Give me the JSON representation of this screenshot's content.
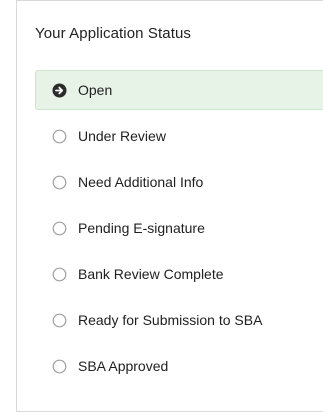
{
  "panel": {
    "title": "Your Application Status"
  },
  "steps": [
    {
      "label": "Open",
      "state": "current",
      "icon": "arrow-circle-right-icon"
    },
    {
      "label": "Under Review",
      "state": "pending",
      "icon": "radio-circle-icon"
    },
    {
      "label": "Need Additional Info",
      "state": "pending",
      "icon": "radio-circle-icon"
    },
    {
      "label": "Pending E-signature",
      "state": "pending",
      "icon": "radio-circle-icon"
    },
    {
      "label": "Bank Review Complete",
      "state": "pending",
      "icon": "radio-circle-icon"
    },
    {
      "label": "Ready for Submission to SBA",
      "state": "pending",
      "icon": "radio-circle-icon"
    },
    {
      "label": "SBA Approved",
      "state": "pending",
      "icon": "radio-circle-icon"
    }
  ],
  "colors": {
    "active_background": "#e7f3e7",
    "active_icon": "#2b2b2b",
    "pending_circle": "#9e9e9e",
    "border": "#d9d9d9"
  }
}
